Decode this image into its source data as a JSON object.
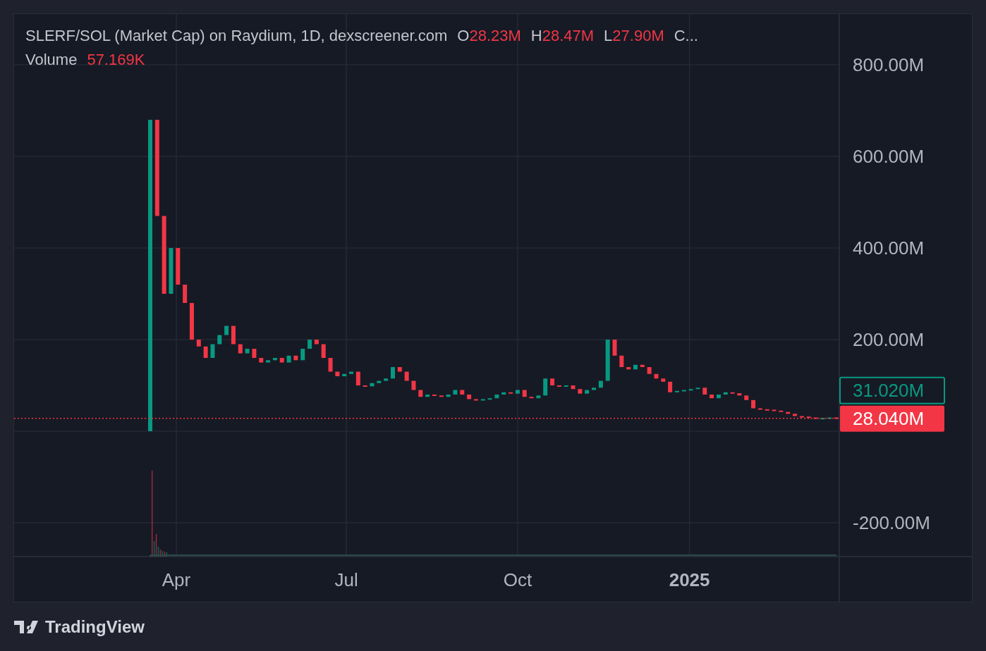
{
  "legend": {
    "title": "SLERF/SOL (Market Cap) on Raydium, 1D, dexscreener.com",
    "ohlc": [
      {
        "label": "O",
        "value": "28.23M"
      },
      {
        "label": "H",
        "value": "28.47M"
      },
      {
        "label": "L",
        "value": "27.90M"
      }
    ],
    "cut": "C...",
    "volume": {
      "label": "Volume",
      "value": "57.169K"
    }
  },
  "price_axis": [
    "800.00M",
    "600.00M",
    "400.00M",
    "200.00M",
    "-200.00M"
  ],
  "time_axis": [
    {
      "label": "Apr",
      "kind": "month"
    },
    {
      "label": "Jul",
      "kind": "month"
    },
    {
      "label": "Oct",
      "kind": "month"
    },
    {
      "label": "2025",
      "kind": "year"
    }
  ],
  "price_tags": [
    {
      "value": "31.020M",
      "kind": "outline"
    },
    {
      "value": "28.040M",
      "kind": "filled"
    }
  ],
  "brand": "TradingView"
}
